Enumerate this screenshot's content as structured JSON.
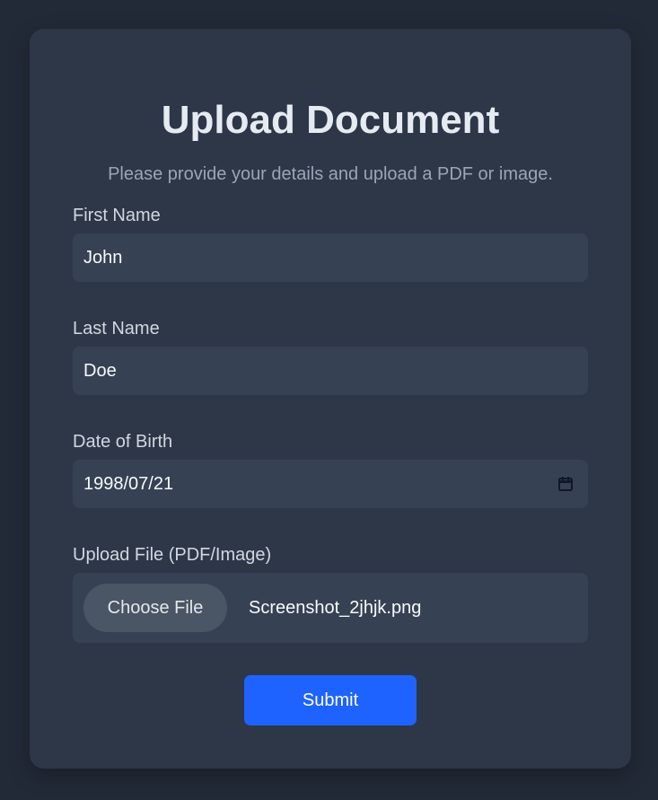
{
  "form": {
    "title": "Upload Document",
    "subtitle": "Please provide your details and upload a PDF or image.",
    "fields": {
      "first_name": {
        "label": "First Name",
        "value": "John"
      },
      "last_name": {
        "label": "Last Name",
        "value": "Doe"
      },
      "dob": {
        "label": "Date of Birth",
        "value": "1998/07/21",
        "icon": "calendar-icon"
      },
      "file": {
        "label": "Upload File (PDF/Image)",
        "button_label": "Choose File",
        "file_name": "Screenshot_2jhjk.png"
      }
    },
    "submit_label": "Submit"
  },
  "colors": {
    "background": "#222a37",
    "card": "#2d3748",
    "input": "#364153",
    "file_button": "#4a5565",
    "accent": "#1e63ff",
    "muted_text": "#9aa5b6"
  }
}
